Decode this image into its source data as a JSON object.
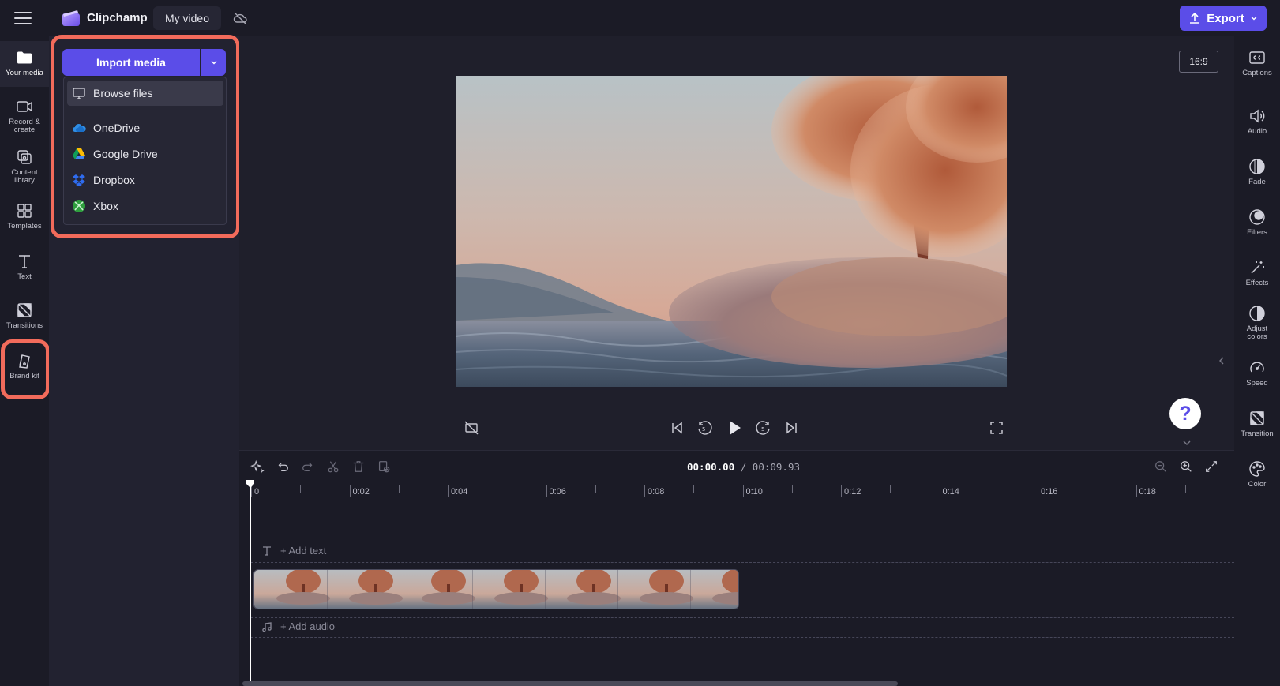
{
  "app": {
    "name": "Clipchamp",
    "project_title": "My video",
    "export_label": "Export",
    "accent_color": "#5b4de8",
    "callout_color": "#f26b5b"
  },
  "left_rail": {
    "your_media": "Your media",
    "record_create": "Record & create",
    "content_library": "Content library",
    "templates": "Templates",
    "text": "Text",
    "transitions": "Transitions",
    "brand_kit": "Brand kit"
  },
  "import": {
    "button_label": "Import media",
    "menu": {
      "browse_files": "Browse files",
      "onedrive": "OneDrive",
      "google_drive": "Google Drive",
      "dropbox": "Dropbox",
      "xbox": "Xbox"
    }
  },
  "preview": {
    "aspect_ratio": "16:9",
    "help_symbol": "?"
  },
  "right_rail": {
    "captions": "Captions",
    "audio": "Audio",
    "fade": "Fade",
    "filters": "Filters",
    "effects": "Effects",
    "adjust_colors": "Adjust colors",
    "speed": "Speed",
    "transition": "Transition",
    "color": "Color"
  },
  "timeline": {
    "current_time": "00:00.00",
    "total_time": "/ 00:09.93",
    "ticks": [
      "0",
      "0:02",
      "0:04",
      "0:06",
      "0:08",
      "0:10",
      "0:12",
      "0:14",
      "0:16",
      "0:18"
    ],
    "add_text": "+ Add text",
    "add_audio": "+ Add audio"
  }
}
